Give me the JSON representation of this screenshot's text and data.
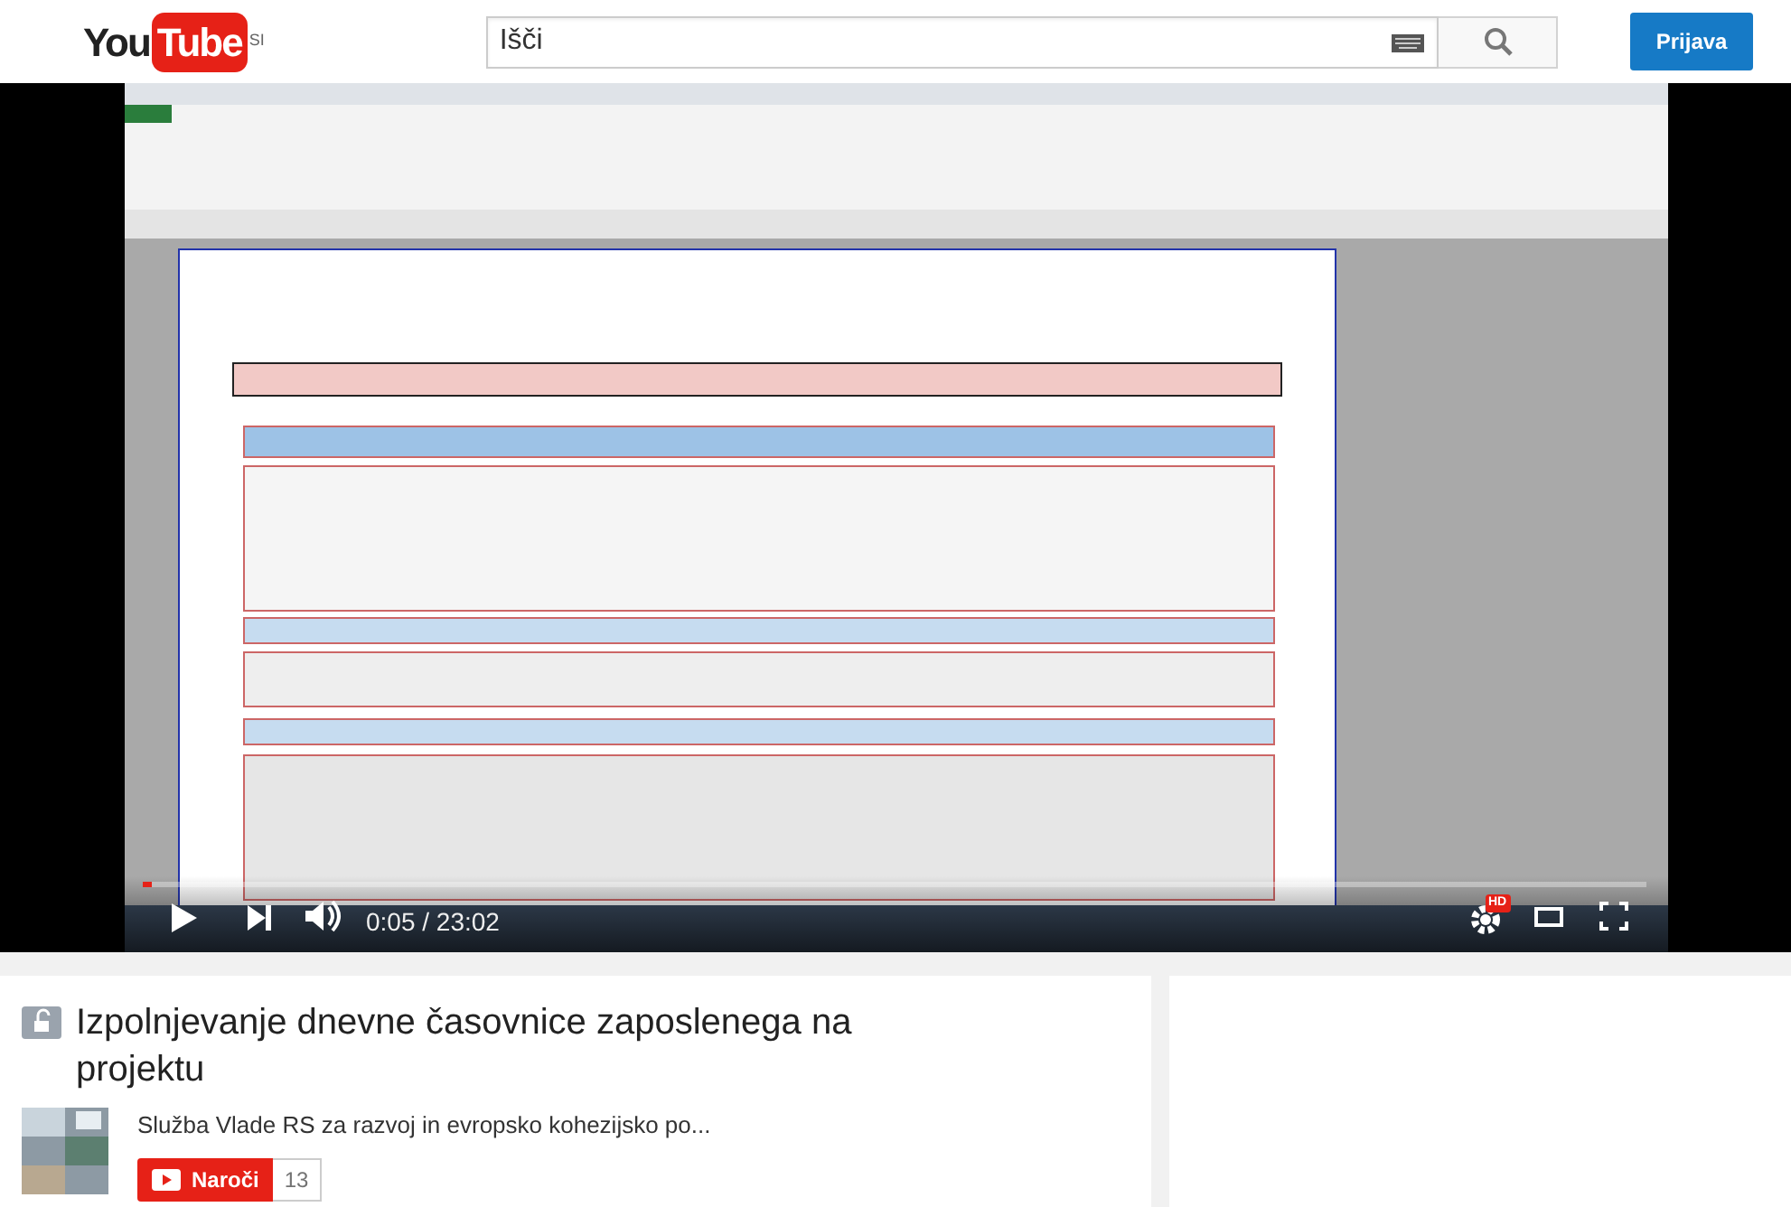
{
  "header": {
    "logo_left": "You",
    "logo_right": "Tube",
    "region": "SI",
    "search": {
      "placeholder": "Išči"
    },
    "sign_in": "Prijava"
  },
  "player": {
    "kind": "picture",
    "progress": {
      "level": 0.007
    },
    "time": "0:05 / 23:02",
    "hd_badge": "HD"
  },
  "video": {
    "title": "Izpolnjevanje dnevne časovnice zaposlenega na projektu",
    "channel": "Služba Vlade RS za razvoj in evropsko kohezijsko po...",
    "subscribe": "Naroči",
    "subscriber_count": "13"
  }
}
